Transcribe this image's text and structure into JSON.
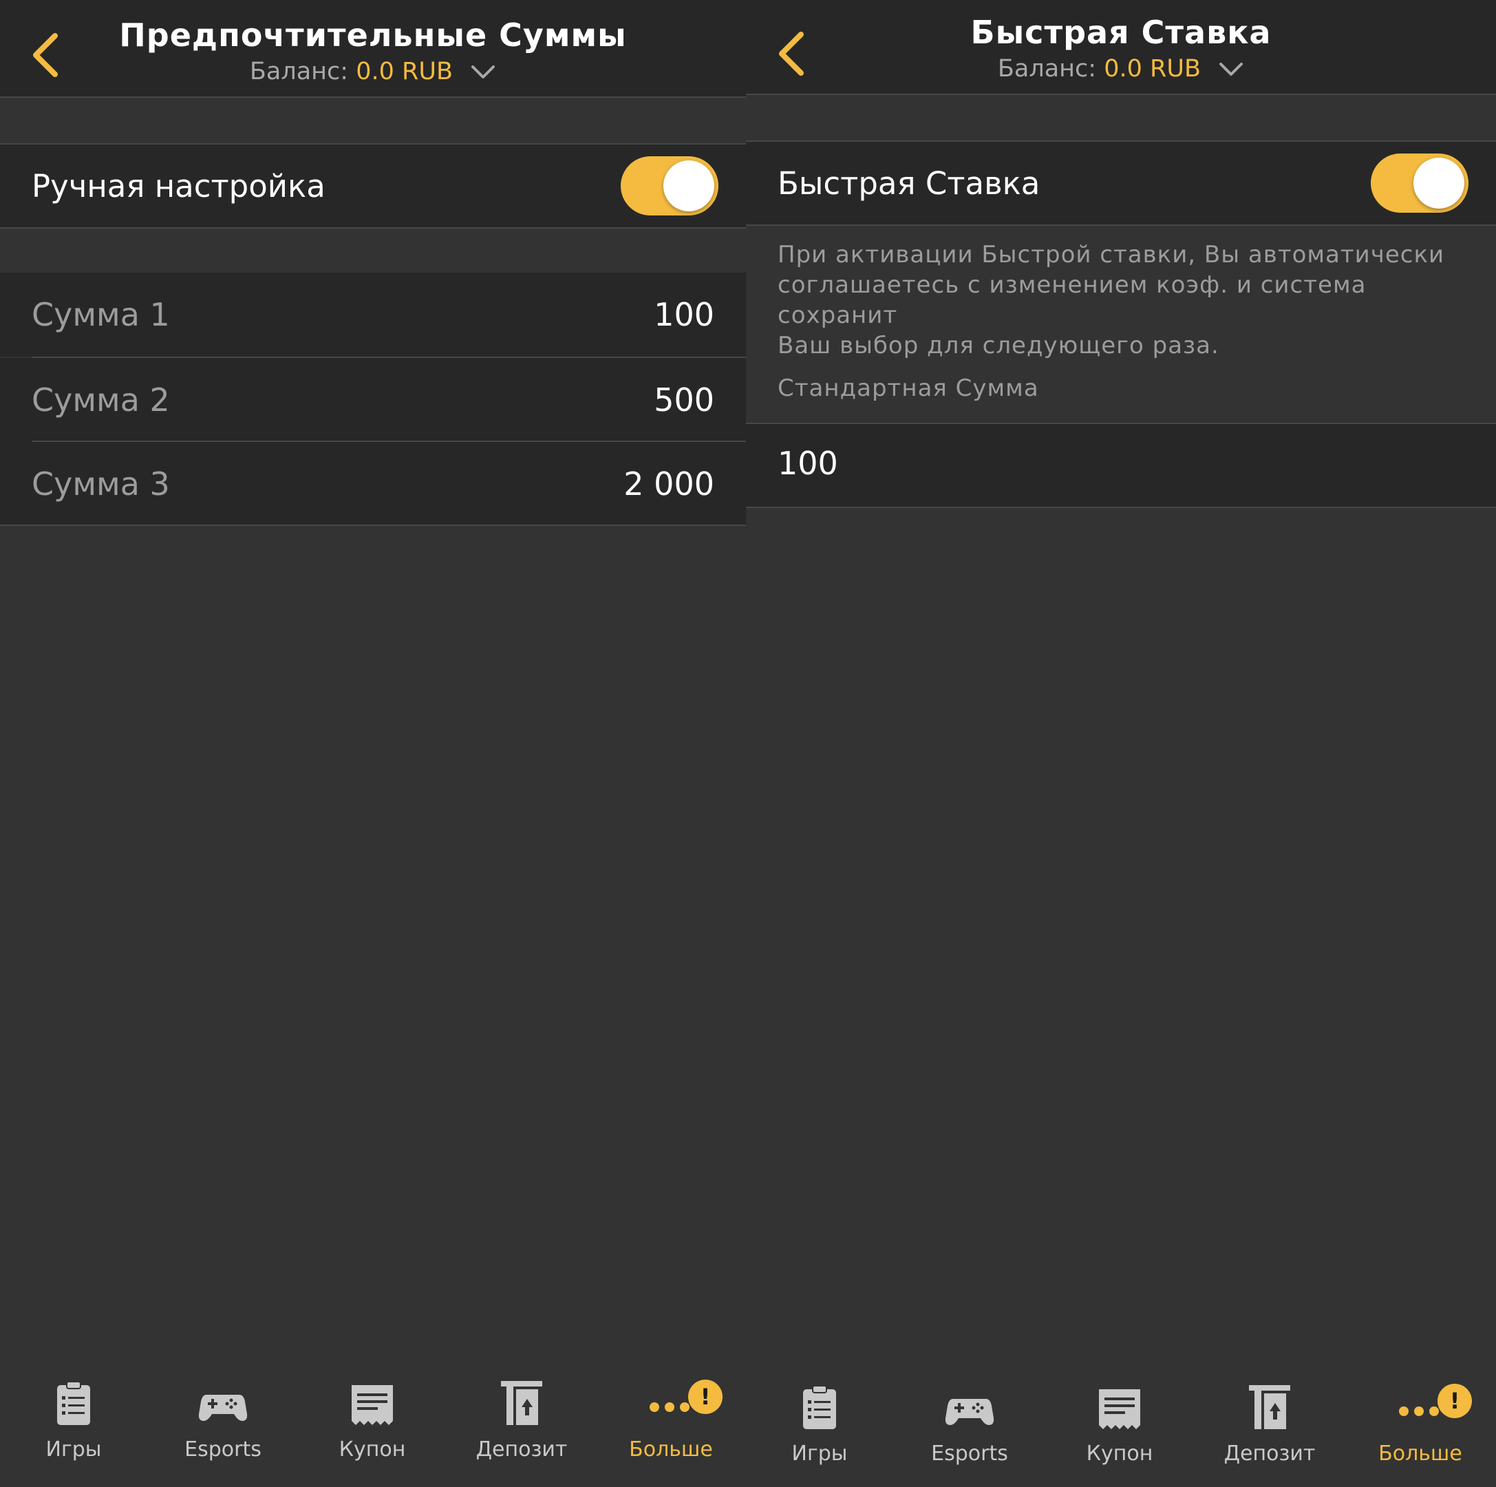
{
  "colors": {
    "accent": "#f4bb40",
    "background": "#333333",
    "row": "#272727",
    "muted_text": "#9c9c9c"
  },
  "left": {
    "header": {
      "title": "Предпочтительные Суммы",
      "balance_label": "Баланс:",
      "balance_value": "0.0 RUB",
      "back_icon": "chevron-left-icon",
      "dropdown_icon": "chevron-down-icon"
    },
    "manual": {
      "label": "Ручная настройка",
      "enabled": true
    },
    "sums": [
      {
        "label": "Сумма 1",
        "value": "100"
      },
      {
        "label": "Сумма 2",
        "value": "500"
      },
      {
        "label": "Сумма 3",
        "value": "2 000"
      }
    ]
  },
  "right": {
    "header": {
      "title": "Быстрая Ставка",
      "balance_label": "Баланс:",
      "balance_value": "0.0 RUB",
      "back_icon": "chevron-left-icon",
      "dropdown_icon": "chevron-down-icon"
    },
    "quick_bet": {
      "label": "Быстрая Ставка",
      "enabled": true
    },
    "description_lines": [
      "При активации Быстрой ставки, Вы автоматически",
      "соглашаетесь с изменением коэф. и система сохранит",
      "Ваш выбор для следующего раза."
    ],
    "default_sum": {
      "caption": "Стандартная Сумма",
      "value": "100"
    }
  },
  "tabbar": {
    "tabs": [
      {
        "label": "Игры",
        "icon": "clipboard-list-icon"
      },
      {
        "label": "Esports",
        "icon": "gamepad-icon"
      },
      {
        "label": "Купон",
        "icon": "receipt-icon"
      },
      {
        "label": "Депозит",
        "icon": "deposit-icon"
      },
      {
        "label": "Больше",
        "icon": "more-dots-icon",
        "active": true,
        "badge": "!"
      }
    ]
  }
}
